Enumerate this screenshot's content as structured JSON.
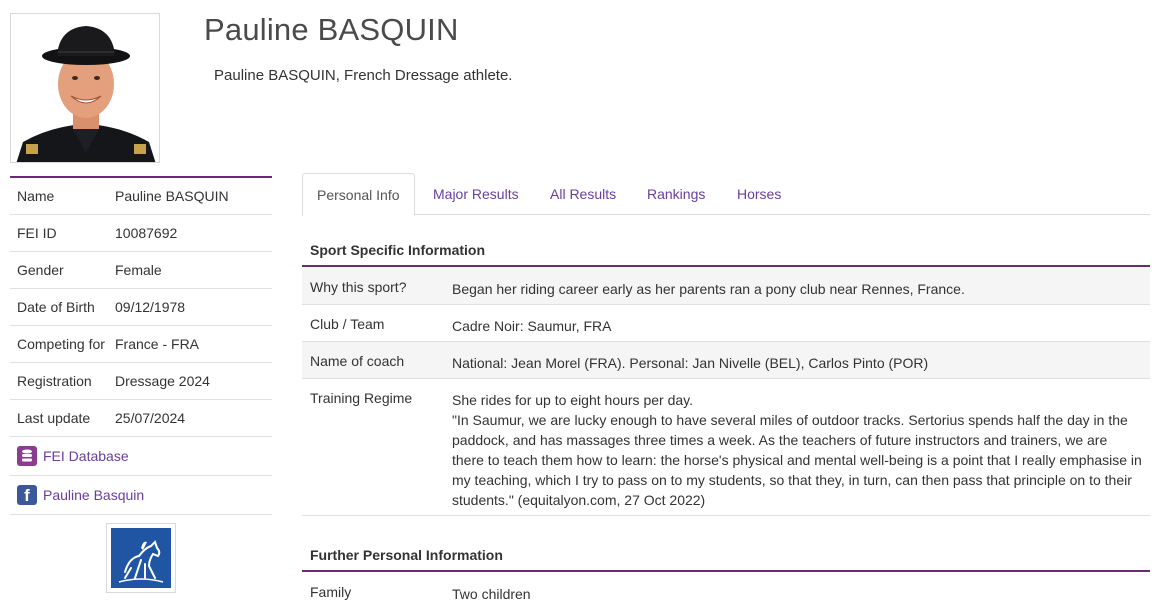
{
  "athlete": {
    "name": "Pauline BASQUIN",
    "subtitle": "Pauline BASQUIN, French Dressage athlete."
  },
  "profile": [
    {
      "label": "Name",
      "value": "Pauline BASQUIN"
    },
    {
      "label": "FEI ID",
      "value": "10087692"
    },
    {
      "label": "Gender",
      "value": "Female"
    },
    {
      "label": "Date of Birth",
      "value": "09/12/1978"
    },
    {
      "label": "Competing for",
      "value": "France - FRA"
    },
    {
      "label": "Registration",
      "value": "Dressage 2024"
    },
    {
      "label": "Last update",
      "value": "25/07/2024"
    }
  ],
  "links": {
    "fei_database": "FEI Database",
    "facebook": "Pauline Basquin"
  },
  "tabs": [
    "Personal Info",
    "Major Results",
    "All Results",
    "Rankings",
    "Horses"
  ],
  "sport_section": {
    "title": "Sport Specific Information",
    "rows": [
      {
        "label": "Why this sport?",
        "value": "Began her riding career early as her parents ran a pony club near Rennes, France."
      },
      {
        "label": "Club / Team",
        "value": "Cadre Noir: Saumur, FRA"
      },
      {
        "label": "Name of coach",
        "value": "National: Jean Morel (FRA). Personal: Jan Nivelle (BEL), Carlos Pinto (POR)"
      },
      {
        "label": "Training Regime",
        "line1": "She rides for up to eight hours per day.",
        "line2": "\"In Saumur, we are lucky enough to have several miles of outdoor tracks. Sertorius spends half the day in the paddock, and has massages three times a week. As the teachers of future instructors and trainers, we are there to teach them how to learn: the horse's physical and mental well-being is a point that I really emphasise in my teaching, which I try to pass on to my students, so that they, in turn, can then pass that principle on to their students.\" (equitalyon.com, 27 Oct 2022)"
      }
    ]
  },
  "personal_section": {
    "title": "Further Personal Information",
    "rows": [
      {
        "label": "Family",
        "value": "Two children"
      }
    ]
  },
  "colors": {
    "accent": "#6a2c70",
    "link": "#6a3e9b",
    "facebook": "#3b5998",
    "database": "#8a3e8e"
  }
}
